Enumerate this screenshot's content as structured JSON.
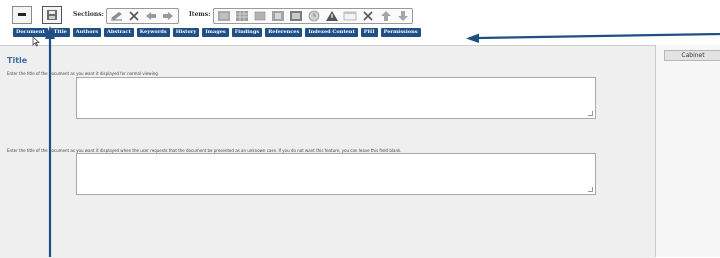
{
  "toolbar": {
    "sections_label": "Sections:",
    "items_label": "Items:",
    "icons": [
      "minus-icon",
      "save-icon",
      "edit-icon",
      "delete-icon",
      "left-arrow-icon",
      "right-arrow-icon",
      "list-icon",
      "table-icon",
      "box-icon",
      "image-icon",
      "grid-icon",
      "clock-icon",
      "warning-icon",
      "window-icon",
      "delete-icon",
      "up-arrow-icon",
      "down-arrow-icon"
    ]
  },
  "tabs": [
    "Document",
    "Title",
    "Authors",
    "Abstract",
    "Keywords",
    "History",
    "Images",
    "Findings",
    "References",
    "Indexed Content",
    "PHI",
    "Permissions"
  ],
  "main": {
    "section_title": "Title",
    "instruction_1": "Enter the title of the document as you want it displayed for normal viewing.",
    "instruction_2": "Enter the title of the document as you want it displayed when the user requests that the document be presented as an unknown case. If you do not want this feature, you can leave this field blank.",
    "textarea_1_value": "",
    "textarea_2_value": ""
  },
  "side_panel": {
    "cabinet_label": "Cabinet"
  },
  "colors": {
    "tab_bg": "#1f4f85",
    "title": "#3a6ea8",
    "annotation_arrow": "#1f4f85"
  }
}
